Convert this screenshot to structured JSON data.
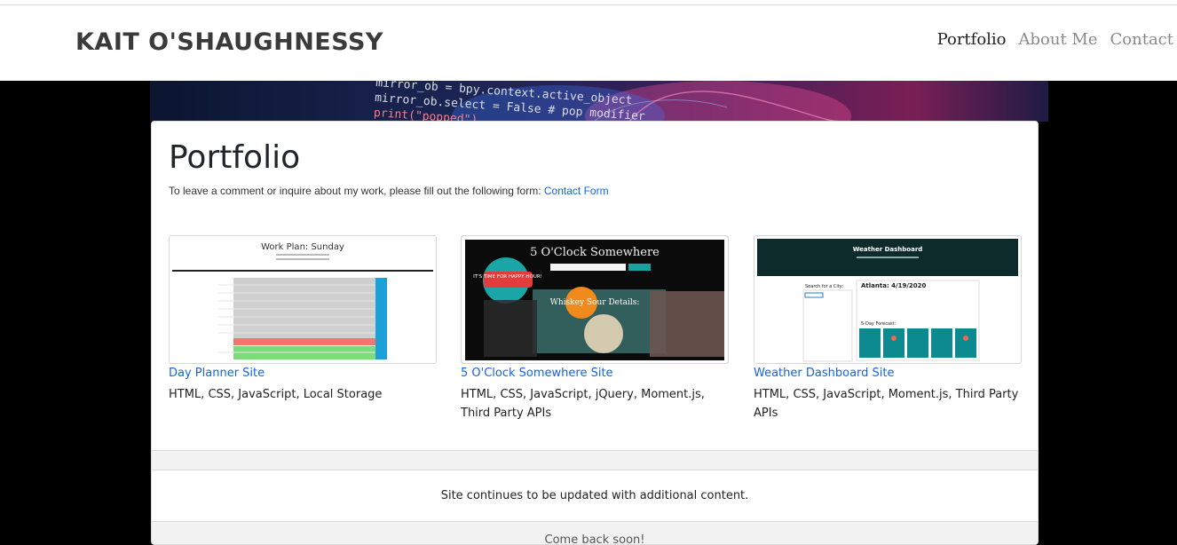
{
  "navbar": {
    "brand": "KAIT O'SHAUGHNESSY",
    "links": [
      {
        "label": "Portfolio",
        "active": true
      },
      {
        "label": "About Me",
        "active": false
      },
      {
        "label": "Contact",
        "active": false
      }
    ]
  },
  "hero": {
    "code_lines": [
      "mirror_ob = bpy.context.active_object",
      "mirror_ob.select = False # pop modifier",
      "print(\"popped\")"
    ]
  },
  "main": {
    "title": "Portfolio",
    "lead_text": "To leave a comment or inquire about my work, please fill out the following form:",
    "lead_link": "Contact Form",
    "projects": [
      {
        "title": "Day Planner Site",
        "tech": "HTML, CSS, JavaScript, Local Storage",
        "thumb_heading": "Work Plan: Sunday"
      },
      {
        "title": "5 O'Clock Somewhere Site",
        "tech": "HTML, CSS, JavaScript, jQuery, Moment.js, Third Party APIs",
        "thumb_heading": "5 O'Clock Somewhere",
        "thumb_badge": "IT'S TIME FOR HAPPY HOUR!",
        "thumb_sub": "Whiskey Sour Details:"
      },
      {
        "title": "Weather Dashboard Site",
        "tech": "HTML, CSS, JavaScript, Moment.js, Third Party APIs",
        "thumb_heading": "Weather Dashboard",
        "thumb_city": "Atlanta: 4/19/2020",
        "thumb_search": "Search for a City:",
        "thumb_forecast": "5-Day Forecast:"
      }
    ]
  },
  "footer": {
    "line1": "Site continues to be updated with additional content.",
    "line2": "Come back soon!"
  },
  "colors": {
    "link": "#1266e0",
    "weather_teal": "#0d8a8f",
    "weather_dark": "#0e2b2b",
    "planner_red": "#f4756f",
    "planner_green": "#7ddb7d",
    "planner_blue": "#1ba1d8"
  }
}
